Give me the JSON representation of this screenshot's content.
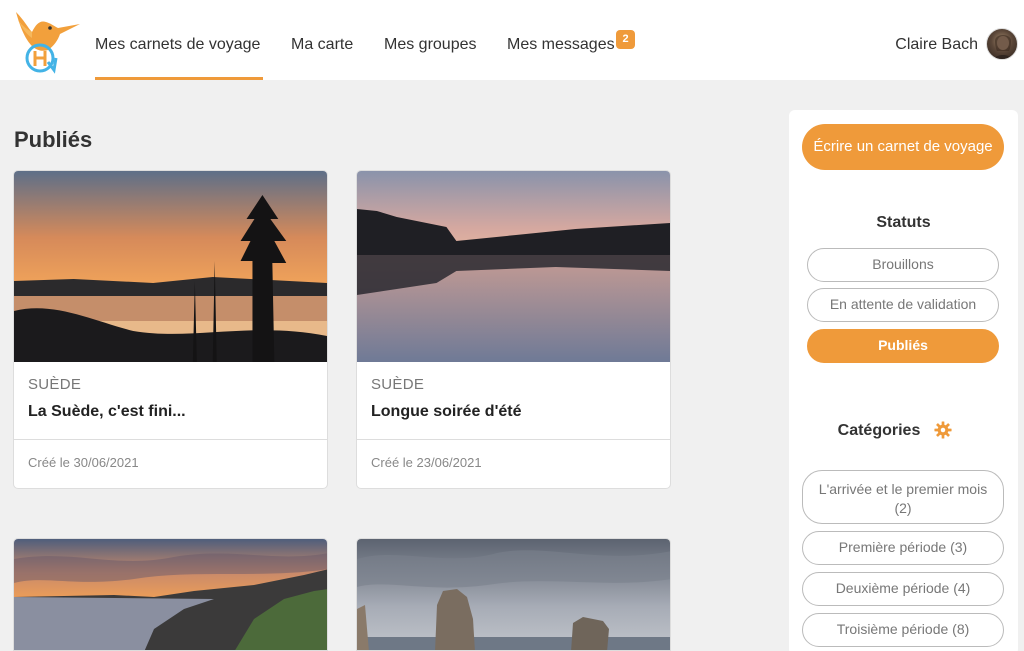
{
  "header": {
    "nav": [
      {
        "label": "Mes carnets de voyage"
      },
      {
        "label": "Ma carte"
      },
      {
        "label": "Mes groupes"
      },
      {
        "label": "Mes messages"
      }
    ],
    "messages_badge": "2",
    "user_name": "Claire Bach",
    "colors": {
      "accent": "#ef9a3a"
    }
  },
  "main": {
    "section_title": "Publiés",
    "cards": [
      {
        "country": "SUÈDE",
        "title": "La Suède, c'est fini...",
        "created": "Créé le 30/06/2021"
      },
      {
        "country": "SUÈDE",
        "title": "Longue soirée d'été",
        "created": "Créé le 23/06/2021"
      }
    ]
  },
  "sidebar": {
    "cta_label": "Écrire un carnet de voyage",
    "statuts_heading": "Statuts",
    "statuts": [
      "Brouillons",
      "En attente de validation",
      "Publiés"
    ],
    "categories_heading": "Catégories",
    "categories": [
      "L'arrivée et le premier mois (2)",
      "Première période (3)",
      "Deuxième période (4)",
      "Troisième période (8)"
    ]
  }
}
